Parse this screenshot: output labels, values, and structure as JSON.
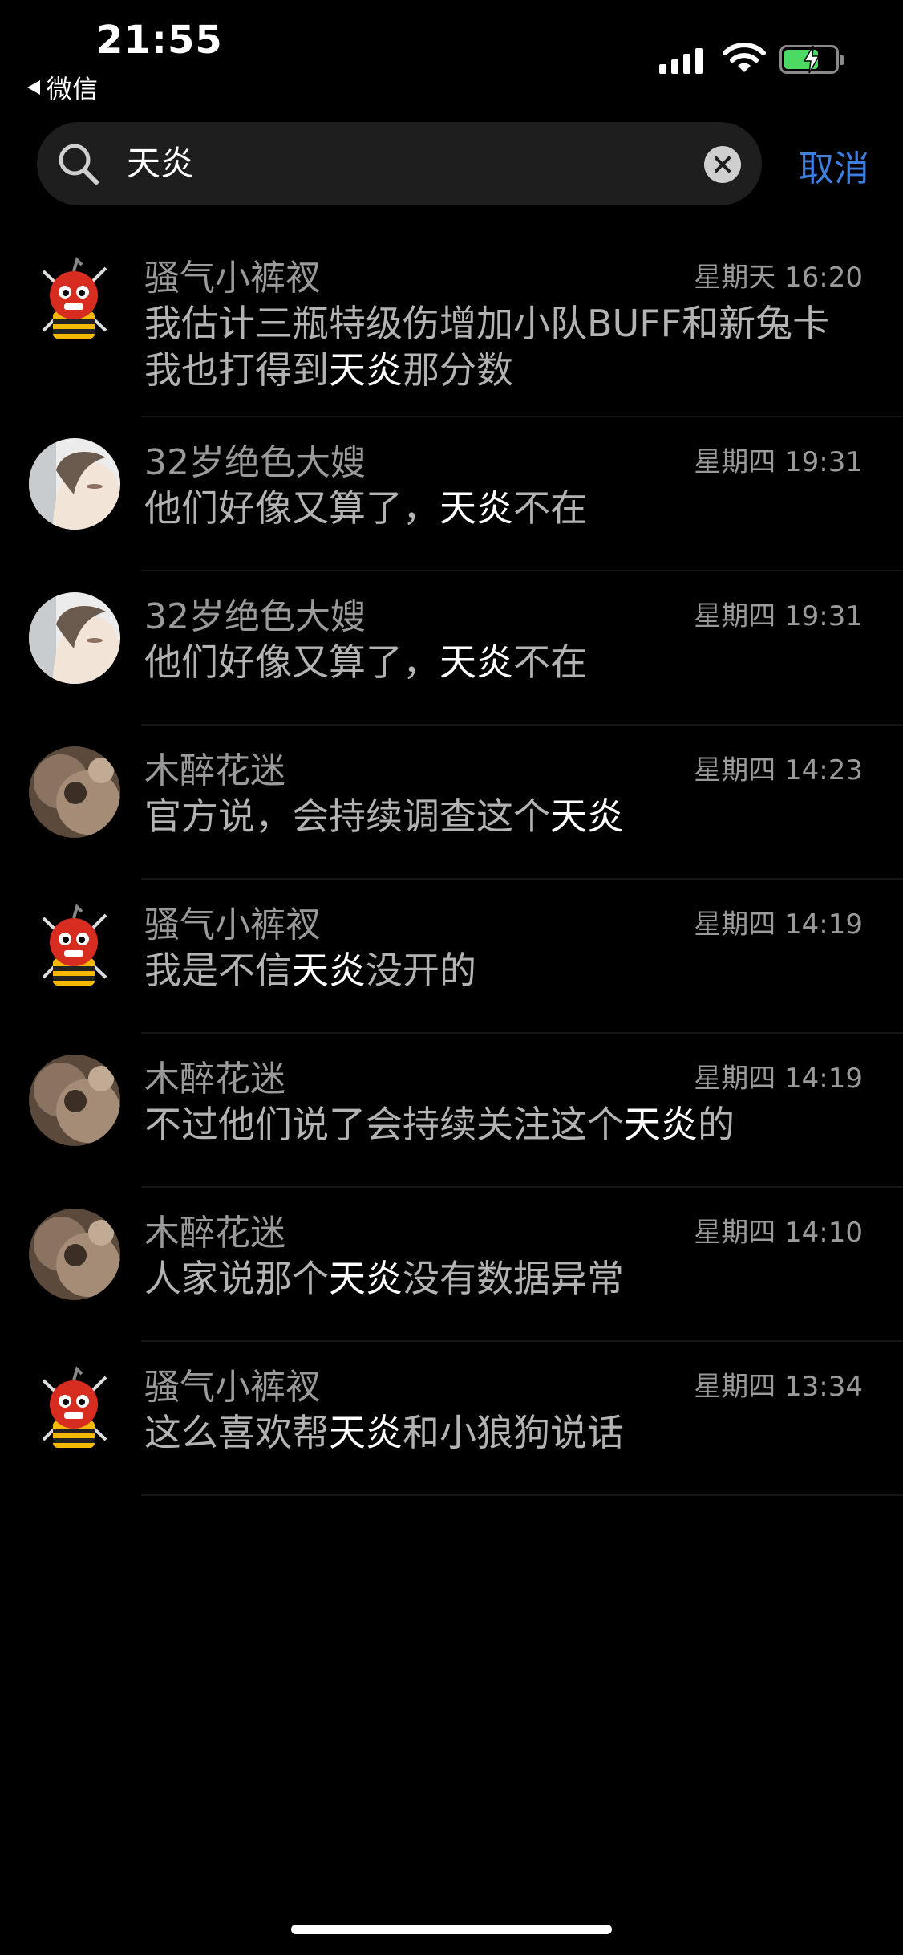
{
  "status_bar": {
    "time": "21:55",
    "back_label": "微信"
  },
  "search": {
    "query": "天炎",
    "cancel_label": "取消"
  },
  "results": [
    {
      "name": "骚气小裤衩",
      "time": "星期天 16:20",
      "avatar": "cartoon-bomb",
      "before": "我估计三瓶特级伤增加小队BUFF和新兔卡我也打得到",
      "highlight": "天炎",
      "after": "那分数"
    },
    {
      "name": "32岁绝色大嫂",
      "time": "星期四 19:31",
      "avatar": "girl-photo",
      "before": "他们好像又算了，",
      "highlight": "天炎",
      "after": "不在"
    },
    {
      "name": "32岁绝色大嫂",
      "time": "星期四 19:31",
      "avatar": "girl-photo",
      "before": "他们好像又算了，",
      "highlight": "天炎",
      "after": "不在"
    },
    {
      "name": "木醉花迷",
      "time": "星期四 14:23",
      "avatar": "pet-photo",
      "before": "官方说，会持续调查这个",
      "highlight": "天炎",
      "after": ""
    },
    {
      "name": "骚气小裤衩",
      "time": "星期四 14:19",
      "avatar": "cartoon-bomb",
      "before": "我是不信",
      "highlight": "天炎",
      "after": "没开的"
    },
    {
      "name": "木醉花迷",
      "time": "星期四 14:19",
      "avatar": "pet-photo",
      "before": "不过他们说了会持续关注这个",
      "highlight": "天炎",
      "after": "的"
    },
    {
      "name": "木醉花迷",
      "time": "星期四 14:10",
      "avatar": "pet-photo",
      "before": "人家说那个",
      "highlight": "天炎",
      "after": "没有数据异常"
    },
    {
      "name": "骚气小裤衩",
      "time": "星期四 13:34",
      "avatar": "cartoon-bomb",
      "before": "这么喜欢帮",
      "highlight": "天炎",
      "after": "和小狼狗说话"
    }
  ],
  "colors": {
    "accent": "#3d7fe0",
    "battery": "#4cd964"
  }
}
